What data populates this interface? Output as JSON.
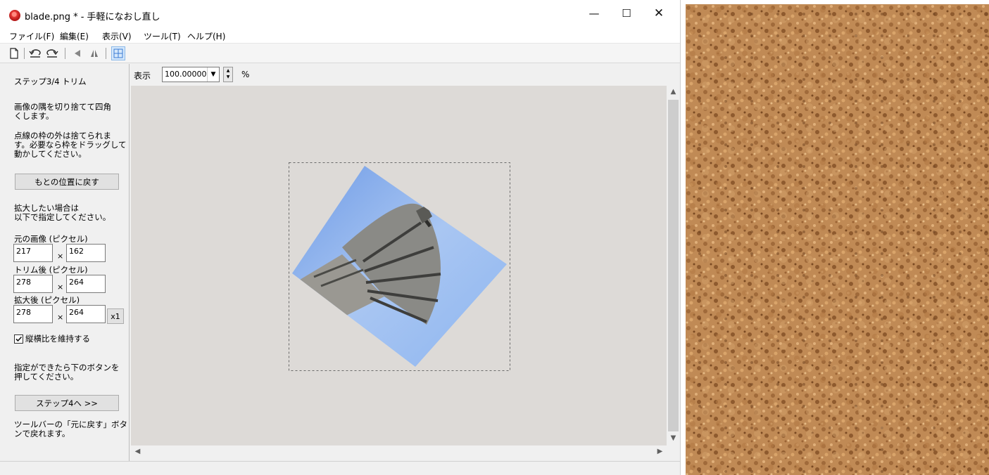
{
  "window": {
    "title": "blade.png * - 手軽になおし直し",
    "controls": {
      "minimize": "—",
      "maximize": "☐",
      "close": "✕"
    }
  },
  "menu": [
    "ファイル(F)",
    "編集(E)",
    "表示(V)",
    "ツール(T)",
    "ヘルプ(H)"
  ],
  "toolbar": {
    "icons": [
      "new-file-icon",
      "rotate-left-icon",
      "rotate-right-icon",
      "flip-horizontal-icon",
      "flip-vertical-icon",
      "grid-icon"
    ]
  },
  "panel": {
    "step_title": "ステップ3/4 トリム",
    "desc1_line1": "画像の隅を切り捨てて四角",
    "desc1_line2": "くします。",
    "desc2_line1": "点線の枠の外は捨てられま",
    "desc2_line2": "す。必要なら枠をドラッグして",
    "desc2_line3": "動かしてください。",
    "reset_button": "もとの位置に戻す",
    "enlarge_line1": "拡大したい場合は",
    "enlarge_line2": "以下で指定してください。",
    "original_label": "元の画像 (ピクセル)",
    "original_w": "217",
    "original_h": "162",
    "trim_label": "トリム後 (ピクセル)",
    "trim_w": "278",
    "trim_h": "264",
    "enlarged_label": "拡大後 (ピクセル)",
    "enlarged_w": "278",
    "enlarged_h": "264",
    "times": "×",
    "x1_button": "x1",
    "keep_aspect": "縦横比を維持する",
    "keep_aspect_checked": true,
    "next_info_line1": "指定ができたら下のボタンを",
    "next_info_line2": "押してください。",
    "next_button": "ステップ4へ >>",
    "undo_info_line1": "ツールバーの「元に戻す」ボタ",
    "undo_info_line2": "ンで戻れます。"
  },
  "zoom": {
    "label": "表示",
    "value": "100.00000",
    "unit": "%"
  },
  "colors": {
    "accent": "#e53935",
    "canvas_bg": "#dddad7",
    "sky": "#8fb4f0",
    "cork": "#c08a55"
  }
}
